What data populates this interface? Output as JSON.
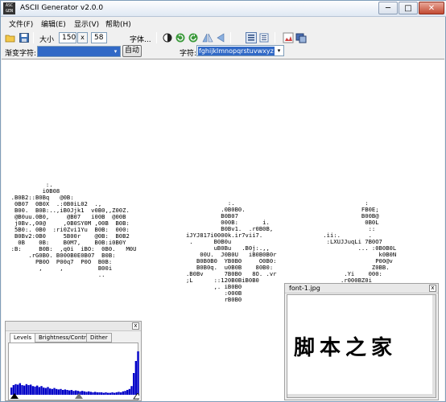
{
  "window": {
    "title": "ASCII Generator v2.0.0",
    "app_icon_text": "ASC\nGEN",
    "min_glyph": "─",
    "max_glyph": "□",
    "close_glyph": "✕"
  },
  "menu": [
    {
      "label": "文件(F)"
    },
    {
      "label": "编辑(E)"
    },
    {
      "label": "显示(V)"
    },
    {
      "label": "帮助(H)"
    }
  ],
  "toolbar": {
    "size_label": "大小",
    "width_value": "150",
    "times_label": "x",
    "height_value": "58",
    "font_button_label": "字体..."
  },
  "toolbar2": {
    "gradient_label": "渐变字符:",
    "auto_button_label": "自动",
    "chars_label": "字符:",
    "chars_value": "fghijklmnopqrstuvwxyz",
    "dropdown_glyph": "▾"
  },
  "ascii_output": {
    "block1": "            :.\n           i0B08\n  .B0B2::B0Bq   @0B:\n   0B07  0B0X  .:0B0iL02  .,\n   B00.  B0B:..,iB0Jjk1  v0B0,,Z00Z.\n   @B0uu.0B0,     @B07   i00B  @00B\n   j0Bv.,00@     ,0B0SY0M ,00B  B0B:\n   5B0:. 0B0  :ri0Zvi1Yu  B0B:  000:\n   B0Bv2:0B0     5B00r    @0B:  B0B2\n    0B    0B:    B0M7,    B0B:i0B0Y\n  :B:     B0B:  ,q0i  iBO:  0B0.   M0U\n       .rG0B0. B000B0E0B07  B0B:\n         PB0O  P00q7  P0O  B0B:\n          ,     ,          B00i\n                           ..",
    "block2": "               :.\n             .0B0B0.\n             B0B07\n             000B:       i.\n             B0Bv1.  .r0B0B,\n   iJYJ817i0000k.ir7vii7.\n    .      B0B0u\n           uB0Bu   .B0j:.,,\n       00U.  J0B0U   iB0B0B0r\n      B0B0B0  YB0B0     O0B0:\n      B0B0q.  u0B0B    80B0:\n   .B0Bv      7B0B0   8O. .vr\n   ;L      ::120B0BiB0B0\n           ,. iB0B0\n              :000B\n              rB0B0",
    "block3": "                :\n               FB0E;\n               B00B@\n                0B0L\n                 ::\n    .ii:.        .\n     :LXUJJuqLi 7B0O7\n              ... :0B0B0L\n                    k0B0N\n                   P00@v\n                  Z0BB.\n          .Yi    000:\n         .r000BZ0i"
  },
  "levels_panel": {
    "tabs": [
      {
        "label": "Levels"
      },
      {
        "label": "Brightness/Contrast"
      },
      {
        "label": "Dither"
      }
    ],
    "close_glyph": "x",
    "histogram": [
      0.15,
      0.2,
      0.22,
      0.21,
      0.24,
      0.2,
      0.19,
      0.22,
      0.2,
      0.21,
      0.18,
      0.17,
      0.19,
      0.16,
      0.18,
      0.15,
      0.14,
      0.16,
      0.13,
      0.12,
      0.14,
      0.12,
      0.11,
      0.12,
      0.1,
      0.11,
      0.1,
      0.09,
      0.1,
      0.08,
      0.09,
      0.08,
      0.07,
      0.08,
      0.07,
      0.06,
      0.07,
      0.06,
      0.05,
      0.06,
      0.05,
      0.05,
      0.05,
      0.04,
      0.05,
      0.04,
      0.04,
      0.05,
      0.04,
      0.05,
      0.06,
      0.05,
      0.07,
      0.08,
      0.1,
      0.12,
      0.18,
      0.45,
      0.7,
      0.9
    ],
    "histogram_color": "#0000c8"
  },
  "preview_panel": {
    "title": "font-1.jpg",
    "close_glyph": "x",
    "image_text": "脚本之家"
  }
}
